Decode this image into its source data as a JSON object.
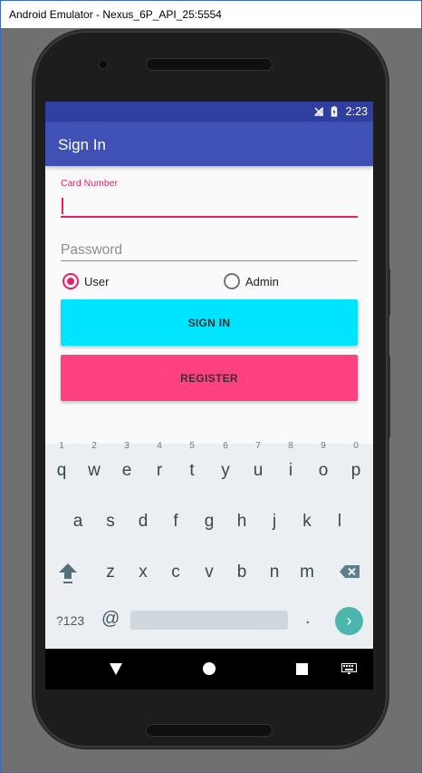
{
  "window": {
    "title": "Android Emulator - Nexus_6P_API_25:5554"
  },
  "status_bar": {
    "time": "2:23"
  },
  "app_bar": {
    "title": "Sign In"
  },
  "form": {
    "card_number_label": "Card Number",
    "card_number_value": "",
    "password_placeholder": "Password",
    "radio_options": [
      {
        "label": "User",
        "checked": true
      },
      {
        "label": "Admin",
        "checked": false
      }
    ],
    "sign_in_label": "SIGN IN",
    "register_label": "REGISTER"
  },
  "keyboard": {
    "row1": [
      {
        "key": "q",
        "hint": "1"
      },
      {
        "key": "w",
        "hint": "2"
      },
      {
        "key": "e",
        "hint": "3"
      },
      {
        "key": "r",
        "hint": "4"
      },
      {
        "key": "t",
        "hint": "5"
      },
      {
        "key": "y",
        "hint": "6"
      },
      {
        "key": "u",
        "hint": "7"
      },
      {
        "key": "i",
        "hint": "8"
      },
      {
        "key": "o",
        "hint": "9"
      },
      {
        "key": "p",
        "hint": "0"
      }
    ],
    "row2": [
      "a",
      "s",
      "d",
      "f",
      "g",
      "h",
      "j",
      "k",
      "l"
    ],
    "row3": [
      "z",
      "x",
      "c",
      "v",
      "b",
      "n",
      "m"
    ],
    "symbols_label": "?123",
    "at_label": "@",
    "period_label": ".",
    "enter_symbol": "›"
  },
  "colors": {
    "status_bar": "#303f9f",
    "app_bar": "#3f51b5",
    "accent": "#e91e63",
    "sign_in_button": "#00e5ff",
    "register_button": "#ff4081",
    "enter_key": "#4db6ac"
  },
  "icons": [
    "no-signal-icon",
    "battery-charging-icon",
    "shift-icon",
    "backspace-icon",
    "back-icon",
    "home-icon",
    "recents-icon",
    "keyboard-switch-icon"
  ]
}
